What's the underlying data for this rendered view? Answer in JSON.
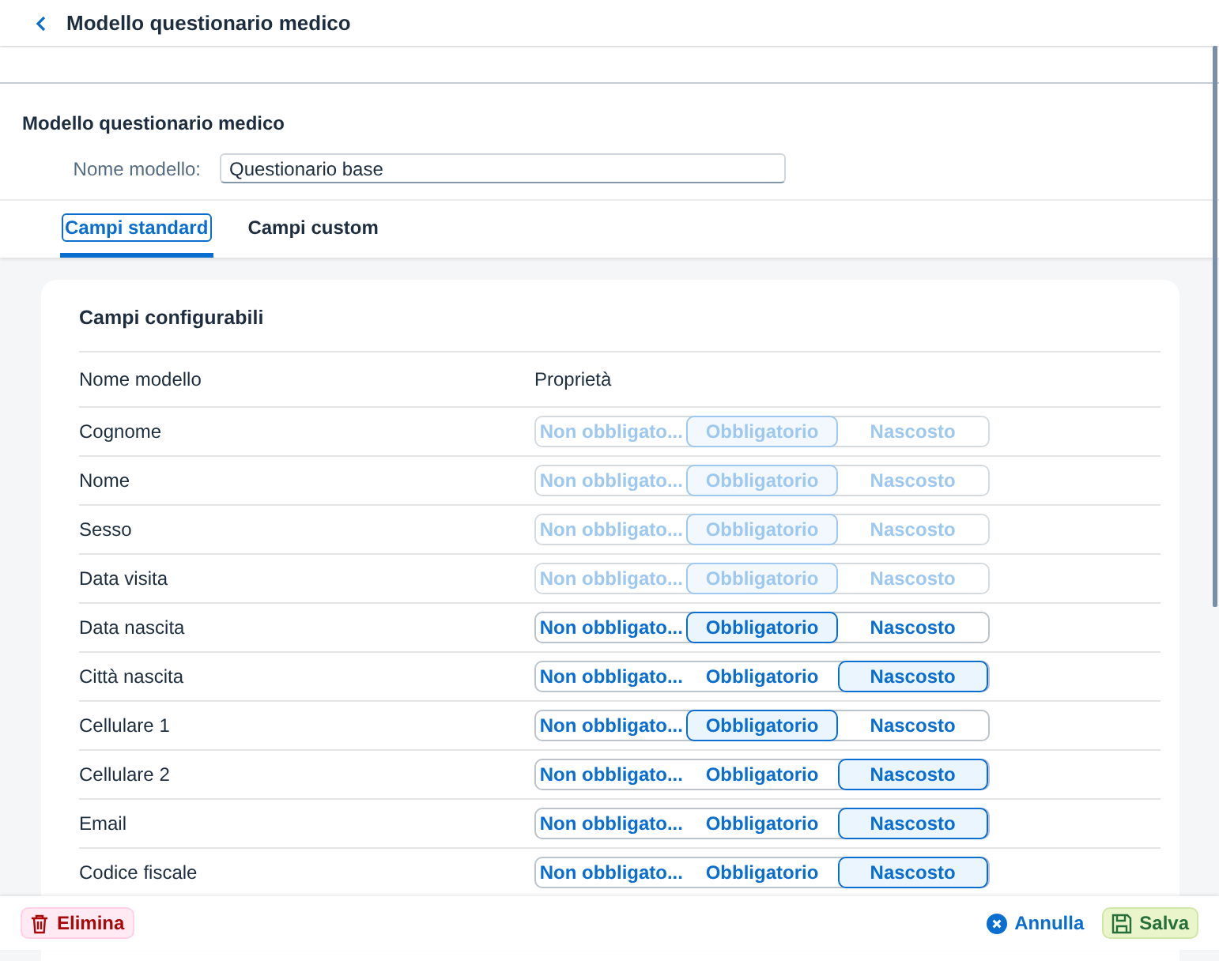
{
  "header": {
    "title": "Modello questionario medico"
  },
  "form": {
    "title": "Modello questionario medico",
    "field_label": "Nome modello:",
    "field_value": "Questionario base"
  },
  "tabs": [
    {
      "label": "Campi standard",
      "selected": true
    },
    {
      "label": "Campi custom",
      "selected": false
    }
  ],
  "card": {
    "title": "Campi configurabili",
    "columns": [
      "Nome modello",
      "Proprietà"
    ],
    "rows": [
      {
        "name": "Cognome",
        "disabled": true,
        "options": [
          {
            "label": "Non obbligato...",
            "selected": false
          },
          {
            "label": "Obbligatorio",
            "selected": true
          },
          {
            "label": "Nascosto",
            "selected": false
          }
        ]
      },
      {
        "name": "Nome",
        "disabled": true,
        "options": [
          {
            "label": "Non obbligato...",
            "selected": false
          },
          {
            "label": "Obbligatorio",
            "selected": true
          },
          {
            "label": "Nascosto",
            "selected": false
          }
        ]
      },
      {
        "name": "Sesso",
        "disabled": true,
        "options": [
          {
            "label": "Non obbligato...",
            "selected": false
          },
          {
            "label": "Obbligatorio",
            "selected": true
          },
          {
            "label": "Nascosto",
            "selected": false
          }
        ]
      },
      {
        "name": "Data visita",
        "disabled": true,
        "options": [
          {
            "label": "Non obbligato...",
            "selected": false
          },
          {
            "label": "Obbligatorio",
            "selected": true
          },
          {
            "label": "Nascosto",
            "selected": false
          }
        ]
      },
      {
        "name": "Data nascita",
        "disabled": false,
        "options": [
          {
            "label": "Non obbligato...",
            "selected": false
          },
          {
            "label": "Obbligatorio",
            "selected": true
          },
          {
            "label": "Nascosto",
            "selected": false
          }
        ]
      },
      {
        "name": "Città nascita",
        "disabled": false,
        "options": [
          {
            "label": "Non obbligato...",
            "selected": false
          },
          {
            "label": "Obbligatorio",
            "selected": false
          },
          {
            "label": "Nascosto",
            "selected": true
          }
        ]
      },
      {
        "name": "Cellulare 1",
        "disabled": false,
        "options": [
          {
            "label": "Non obbligato...",
            "selected": false
          },
          {
            "label": "Obbligatorio",
            "selected": true
          },
          {
            "label": "Nascosto",
            "selected": false
          }
        ]
      },
      {
        "name": "Cellulare 2",
        "disabled": false,
        "options": [
          {
            "label": "Non obbligato...",
            "selected": false
          },
          {
            "label": "Obbligatorio",
            "selected": false
          },
          {
            "label": "Nascosto",
            "selected": true
          }
        ]
      },
      {
        "name": "Email",
        "disabled": false,
        "options": [
          {
            "label": "Non obbligato...",
            "selected": false
          },
          {
            "label": "Obbligatorio",
            "selected": false
          },
          {
            "label": "Nascosto",
            "selected": true
          }
        ]
      },
      {
        "name": "Codice fiscale",
        "disabled": false,
        "options": [
          {
            "label": "Non obbligato...",
            "selected": false
          },
          {
            "label": "Obbligatorio",
            "selected": false
          },
          {
            "label": "Nascosto",
            "selected": true
          }
        ]
      }
    ]
  },
  "footer": {
    "delete": "Elimina",
    "cancel": "Annulla",
    "save": "Salva"
  }
}
